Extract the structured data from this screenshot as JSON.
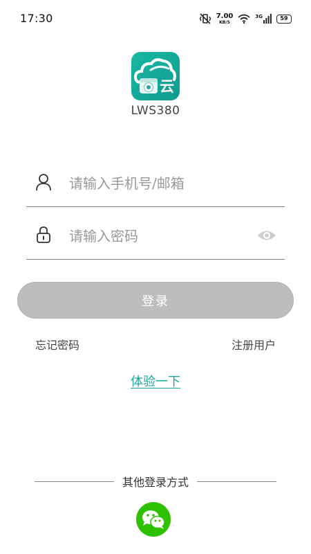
{
  "status_bar": {
    "time": "17:30",
    "net_speed_value": "7.00",
    "net_speed_unit": "KB/S",
    "network_type": "3G",
    "battery": "59"
  },
  "app": {
    "logo_char": "云",
    "name": "LWS380"
  },
  "form": {
    "account_placeholder": "请输入手机号/邮箱",
    "password_placeholder": "请输入密码",
    "login_label": "登录"
  },
  "links": {
    "forgot_password": "忘记密码",
    "register": "注册用户",
    "trial": "体验一下"
  },
  "other_login": {
    "label": "其他登录方式"
  },
  "colors": {
    "accent": "#1aa89a",
    "button_disabled": "#bdbdbd",
    "wechat": "#2dc100"
  }
}
